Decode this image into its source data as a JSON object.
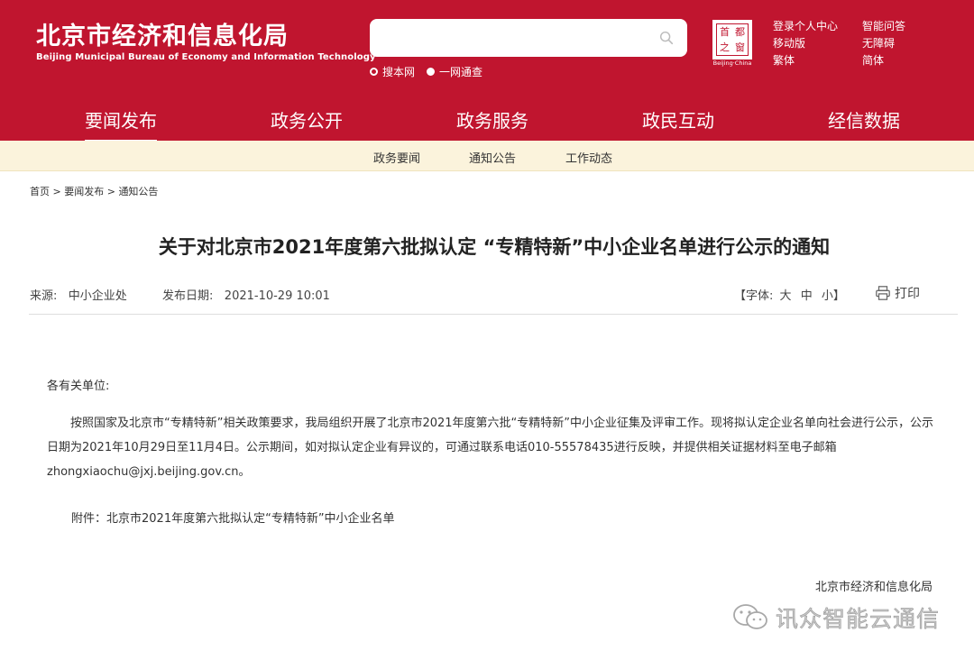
{
  "site": {
    "title_cn": "北京市经济和信息化局",
    "title_en": "Beijing Municipal Bureau of Economy and Information Technology"
  },
  "search": {
    "placeholder": "",
    "scope_site": "搜本网",
    "scope_all": "一网通查"
  },
  "seal": {
    "chars": [
      "首",
      "都",
      "之",
      "窗"
    ],
    "caption": "Beijing·China"
  },
  "toplinks": {
    "col1": [
      "登录个人中心",
      "移动版",
      "繁体"
    ],
    "col2": [
      "智能问答",
      "无障碍",
      "简体"
    ]
  },
  "nav": {
    "items": [
      "要闻发布",
      "政务公开",
      "政务服务",
      "政民互动",
      "经信数据"
    ],
    "active": "要闻发布"
  },
  "subnav": {
    "items": [
      "政务要闻",
      "通知公告",
      "工作动态"
    ]
  },
  "breadcrumb": {
    "items": [
      "首页",
      "要闻发布",
      "通知公告"
    ],
    "separator": ">"
  },
  "article": {
    "title": "关于对北京市2021年度第六批拟认定 “专精特新”中小企业名单进行公示的通知",
    "source_label": "来源:",
    "source": "中小企业处",
    "date_label": "发布日期:",
    "date": "2021-10-29 10:01",
    "font_label": "【字体:",
    "font_large": "大",
    "font_medium": "中",
    "font_small": "小】",
    "print_label": "打印",
    "salutation": "各有关单位:",
    "body": "按照国家及北京市“专精特新”相关政策要求，我局组织开展了北京市2021年度第六批“专精特新”中小企业征集及评审工作。现将拟认定企业名单向社会进行公示，公示日期为2021年10月29日至11月4日。公示期间，如对拟认定企业有异议的，可通过联系电话010-55578435进行反映，并提供相关证据材料至电子邮箱zhongxiaochu@jxj.beijing.gov.cn。",
    "attachment": "附件：北京市2021年度第六批拟认定“专精特新”中小企业名单",
    "signature": "北京市经济和信息化局"
  },
  "watermark": {
    "text": "讯众智能云通信",
    "icon": "wechat-icon"
  },
  "colors": {
    "brand_red": "#c0152f",
    "subnav_bg": "#fbf3dc"
  }
}
